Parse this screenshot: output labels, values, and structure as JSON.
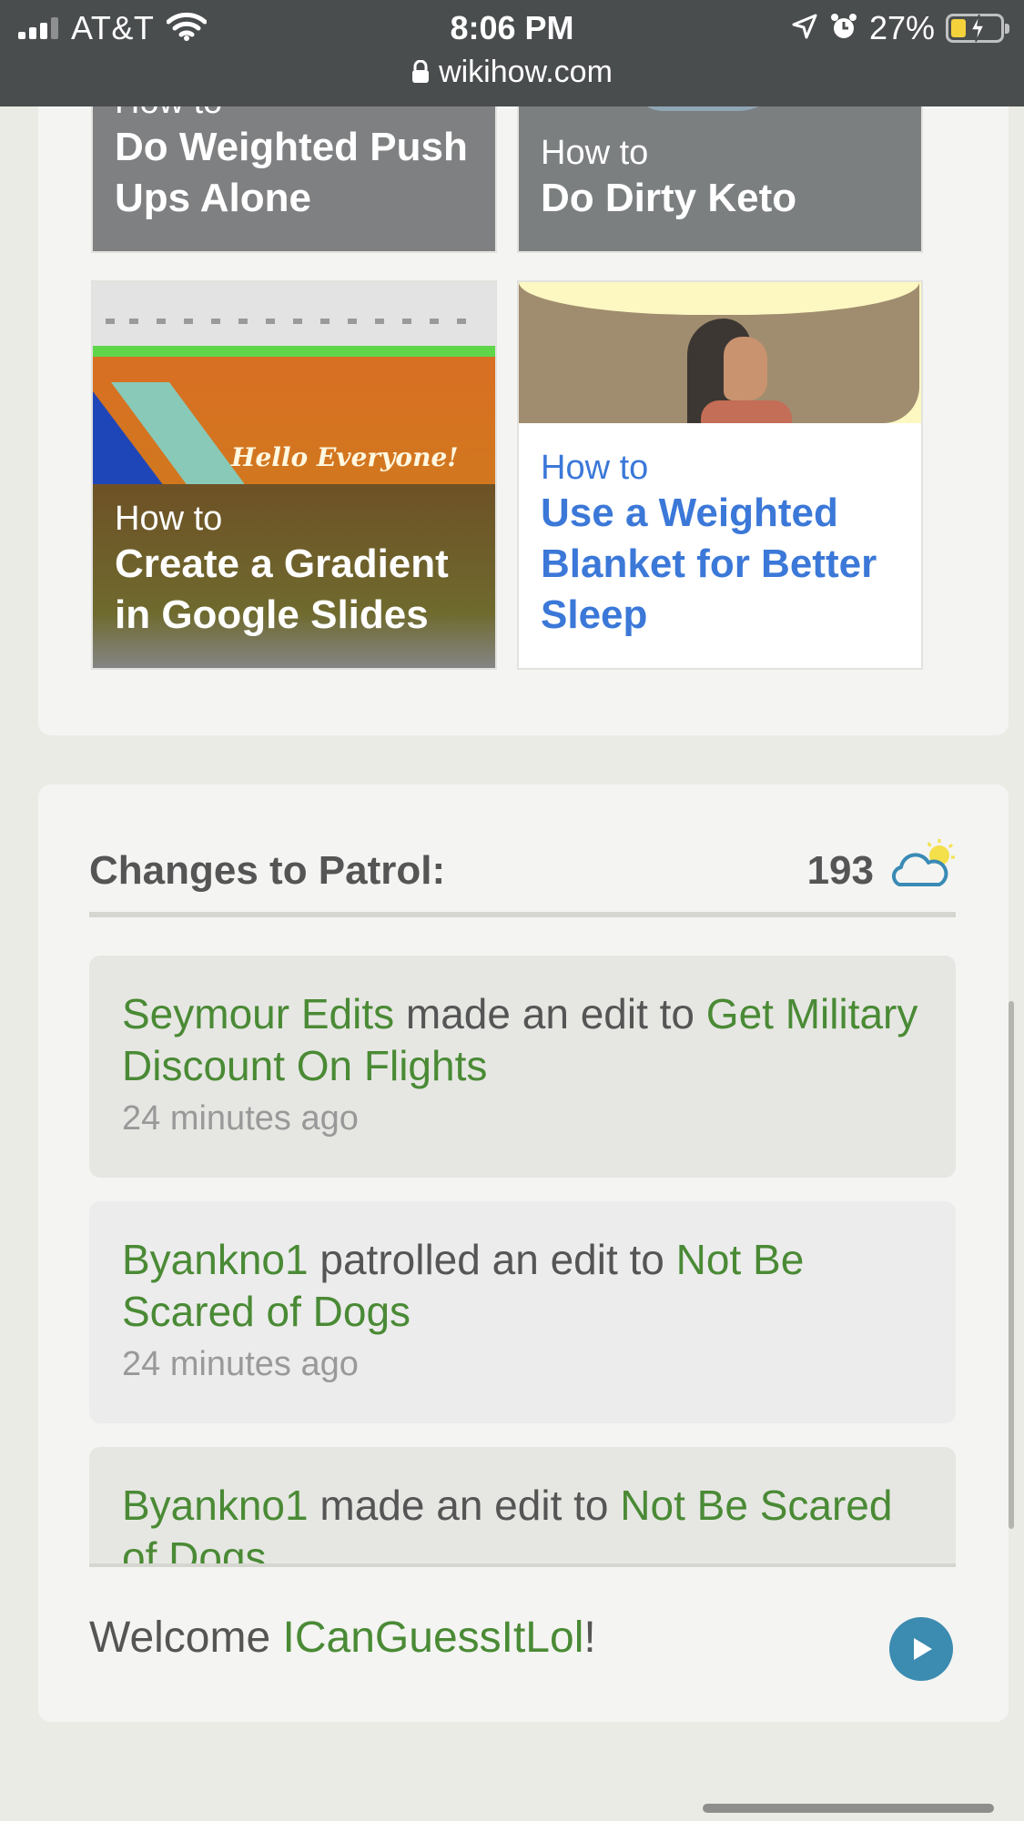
{
  "status_bar": {
    "carrier": "AT&T",
    "time": "8:06 PM",
    "url": "wikihow.com",
    "battery_percent": "27%",
    "battery_level": 0.27,
    "icons": [
      "signal-icon",
      "wifi-icon",
      "lock-icon",
      "location-arrow-icon",
      "alarm-icon",
      "battery-charging-icon"
    ]
  },
  "related": {
    "tiles": [
      {
        "prefix": "How to",
        "title": "Do Weighted Push Ups Alone"
      },
      {
        "prefix": "How to",
        "title": "Do Dirty Keto"
      },
      {
        "prefix": "How to",
        "title": "Create a Gradient in Google Slides",
        "image_text": "Hello Everyone!"
      },
      {
        "prefix": "How to",
        "title": "Use a Weighted Blanket for Better Sleep"
      }
    ]
  },
  "patrol": {
    "title": "Changes to Patrol:",
    "count": "193",
    "weather_icon": "partly-cloudy-icon",
    "items": [
      {
        "user": "Seymour Edits",
        "action": " made an edit to ",
        "article": "Get Military Discount On Flights",
        "time": "24 minutes ago"
      },
      {
        "user": "Byankno1",
        "action": " patrolled an edit to ",
        "article": "Not Be Scared of Dogs",
        "time": "24 minutes ago"
      },
      {
        "user": "Byankno1",
        "action": " made an edit to ",
        "article": "Not Be Scared of Dogs",
        "time": ""
      }
    ],
    "welcome_prefix": "Welcome ",
    "welcome_user": "ICanGuessItLol",
    "welcome_suffix": "!"
  },
  "colors": {
    "link_green": "#4a8a35",
    "link_blue": "#3b78d8",
    "play_button": "#3c8bb0",
    "status_bar_bg": "#4a4d4e"
  }
}
